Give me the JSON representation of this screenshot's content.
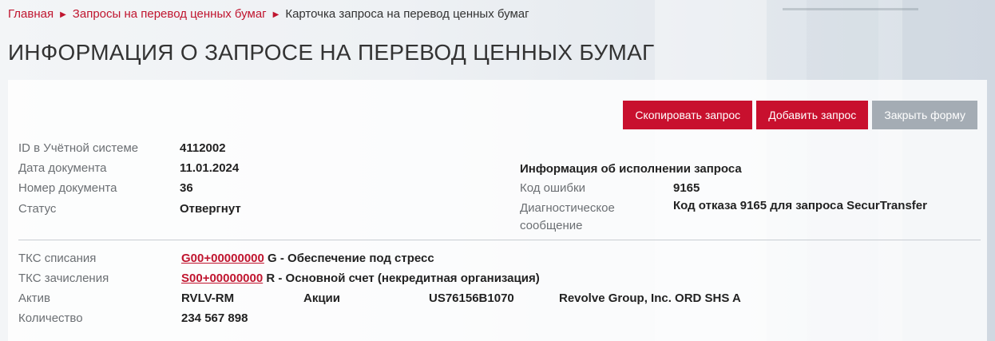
{
  "breadcrumb": {
    "items": [
      "Главная",
      "Запросы на перевод ценных бумаг"
    ],
    "current": "Карточка запроса на перевод ценных бумаг"
  },
  "page_title": "ИНФОРМАЦИЯ О ЗАПРОСЕ НА ПЕРЕВОД ЦЕННЫХ БУМАГ",
  "buttons": {
    "copy": "Скопировать запрос",
    "add": "Добавить запрос",
    "close": "Закрыть форму"
  },
  "doc": {
    "id_label": "ID в Учётной системе",
    "id_value": "4112002",
    "date_label": "Дата документа",
    "date_value": "11.01.2024",
    "number_label": "Номер документа",
    "number_value": "36",
    "status_label": "Статус",
    "status_value": "Отвергнут"
  },
  "execution": {
    "title": "Информация об исполнении запроса",
    "error_label": "Код ошибки",
    "error_value": "9165",
    "diag_label_1": "Диагностическое",
    "diag_label_2": "сообщение",
    "diag_value": "Код отказа 9165 для запроса SecurTransfer"
  },
  "transfer": {
    "debit_label": "ТКС списания",
    "debit_link": "G00+00000000",
    "debit_desc": "G - Обеспечение под стресс",
    "credit_label": "ТКС зачисления",
    "credit_link": "S00+00000000",
    "credit_desc": "R - Основной счет (некредитная организация)",
    "asset_label": "Актив",
    "asset_code": "RVLV-RM",
    "asset_type": "Акции",
    "asset_isin": "US76156B1070",
    "asset_name": "Revolve Group, Inc. ORD SHS A",
    "qty_label": "Количество",
    "qty_value": "234 567 898"
  },
  "colors": {
    "accent": "#c8102e",
    "button_gray": "#a4acb4",
    "link": "#c0152f"
  }
}
